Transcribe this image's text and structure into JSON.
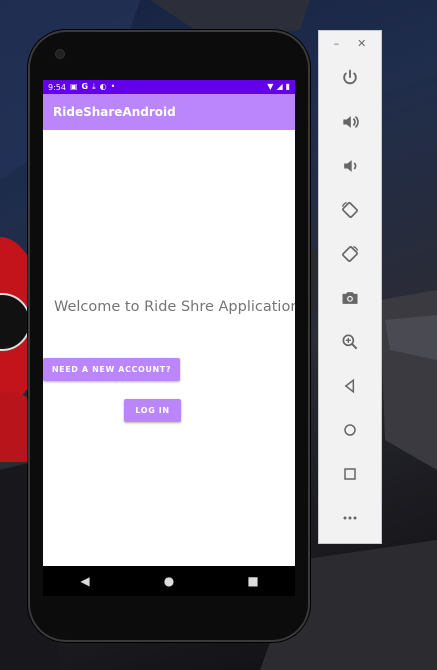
{
  "status_bar": {
    "time": "9:54",
    "left_icons": [
      "message-icon",
      "google-icon",
      "download-icon",
      "sync-icon",
      "dot-icon"
    ],
    "right_icons": [
      "wifi-icon",
      "signal-icon",
      "battery-icon"
    ]
  },
  "app": {
    "title": "RideShareAndroid",
    "welcome_text": "Welcome to Ride Shre Application",
    "new_account_button": "NEED A NEW ACCOUNT?",
    "login_button": "LOG IN"
  },
  "nav": {
    "back": "◀",
    "home": "●",
    "recents": "■"
  },
  "toolbar": {
    "minimize": "–",
    "close": "✕",
    "items": [
      "power-icon",
      "volume-up-icon",
      "volume-down-icon",
      "rotate-left-icon",
      "rotate-right-icon",
      "camera-icon",
      "zoom-icon",
      "back-icon",
      "home-icon",
      "overview-icon",
      "more-icon"
    ]
  },
  "colors": {
    "status_bar": "#6200ee",
    "app_bar": "#bb86fc",
    "button": "#bb86fc",
    "welcome_text": "#757575"
  }
}
